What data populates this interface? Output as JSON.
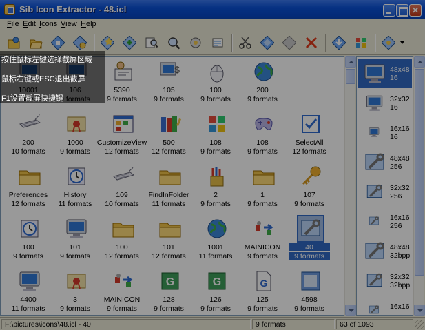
{
  "window": {
    "title": "Sib Icon Extractor - 48.icl"
  },
  "menu": [
    {
      "label": "File",
      "u": "F",
      "rest": "ile"
    },
    {
      "label": "Edit",
      "u": "E",
      "rest": "dit"
    },
    {
      "label": "Icons",
      "u": "I",
      "rest": "cons"
    },
    {
      "label": "View",
      "u": "V",
      "rest": "iew"
    },
    {
      "label": "Help",
      "u": "H",
      "rest": "elp"
    }
  ],
  "toolbar": [
    "open-file-icon",
    "open-folder-icon",
    "scan-icon",
    "open-library-icon",
    "new-library-icon",
    "add-icon",
    "find-icon",
    "zoom-icon",
    "explore-icon",
    "properties-icon",
    "cut-icon",
    "copy-icon",
    "paste-icon",
    "delete-icon",
    "export-icon",
    "windows-icon",
    "options-icon"
  ],
  "icons": [
    [
      {
        "n": "10001",
        "f": "9 formats"
      },
      {
        "n": "106",
        "f": "9 formats"
      },
      {
        "n": "5390",
        "f": "9 formats"
      },
      {
        "n": "105",
        "f": "9 formats"
      },
      {
        "n": "100",
        "f": "9 formats"
      },
      {
        "n": "200",
        "f": "9 formats"
      }
    ],
    [
      {
        "n": "200",
        "f": "10 formats"
      },
      {
        "n": "1000",
        "f": "9 formats"
      },
      {
        "n": "CustomizeView",
        "f": "12 formats"
      },
      {
        "n": "500",
        "f": "12 formats"
      },
      {
        "n": "108",
        "f": "9 formats"
      },
      {
        "n": "108",
        "f": "9 formats"
      },
      {
        "n": "SelectAll",
        "f": "12 formats"
      }
    ],
    [
      {
        "n": "Preferences",
        "f": "12 formats"
      },
      {
        "n": "History",
        "f": "11 formats"
      },
      {
        "n": "109",
        "f": "10 formats"
      },
      {
        "n": "FindInFolder",
        "f": "11 formats"
      },
      {
        "n": "2",
        "f": "9 formats"
      },
      {
        "n": "1",
        "f": "9 formats"
      },
      {
        "n": "107",
        "f": "9 formats"
      }
    ],
    [
      {
        "n": "100",
        "f": "9 formats"
      },
      {
        "n": "101",
        "f": "9 formats"
      },
      {
        "n": "100",
        "f": "12 formats"
      },
      {
        "n": "101",
        "f": "12 formats"
      },
      {
        "n": "1001",
        "f": "11 formats"
      },
      {
        "n": "MAINICON",
        "f": "9 formats"
      },
      {
        "n": "40",
        "f": "9 formats"
      }
    ],
    [
      {
        "n": "4400",
        "f": "11 formats"
      },
      {
        "n": "3",
        "f": "9 formats"
      },
      {
        "n": "MAINICON",
        "f": "9 formats"
      },
      {
        "n": "128",
        "f": "9 formats"
      },
      {
        "n": "126",
        "f": "9 formats"
      },
      {
        "n": "125",
        "f": "9 formats"
      },
      {
        "n": "4598",
        "f": "9 formats"
      }
    ]
  ],
  "selected_icon": "40",
  "formats": [
    {
      "size": "48x48",
      "depth": "16"
    },
    {
      "size": "32x32",
      "depth": "16"
    },
    {
      "size": "16x16",
      "depth": "16"
    },
    {
      "size": "48x48",
      "depth": "256"
    },
    {
      "size": "32x32",
      "depth": "256"
    },
    {
      "size": "16x16",
      "depth": "256"
    },
    {
      "size": "48x48",
      "depth": "32bpp"
    },
    {
      "size": "32x32",
      "depth": "32bpp"
    },
    {
      "size": "16x16",
      "depth": ""
    }
  ],
  "status": {
    "path": "F:\\pictures\\icons\\48.icl - 40",
    "formats": "9 formats",
    "count": "63 of 1093"
  },
  "overlay": {
    "line1": "按住鼠标左键选择截屏区域",
    "line2": "鼠标右键或ESC退出截屏",
    "line3": "F1设置截屏快捷键"
  },
  "colors": {
    "selection": "#316ac5",
    "titlebar": "#0a52d9",
    "face": "#ece9d8"
  }
}
